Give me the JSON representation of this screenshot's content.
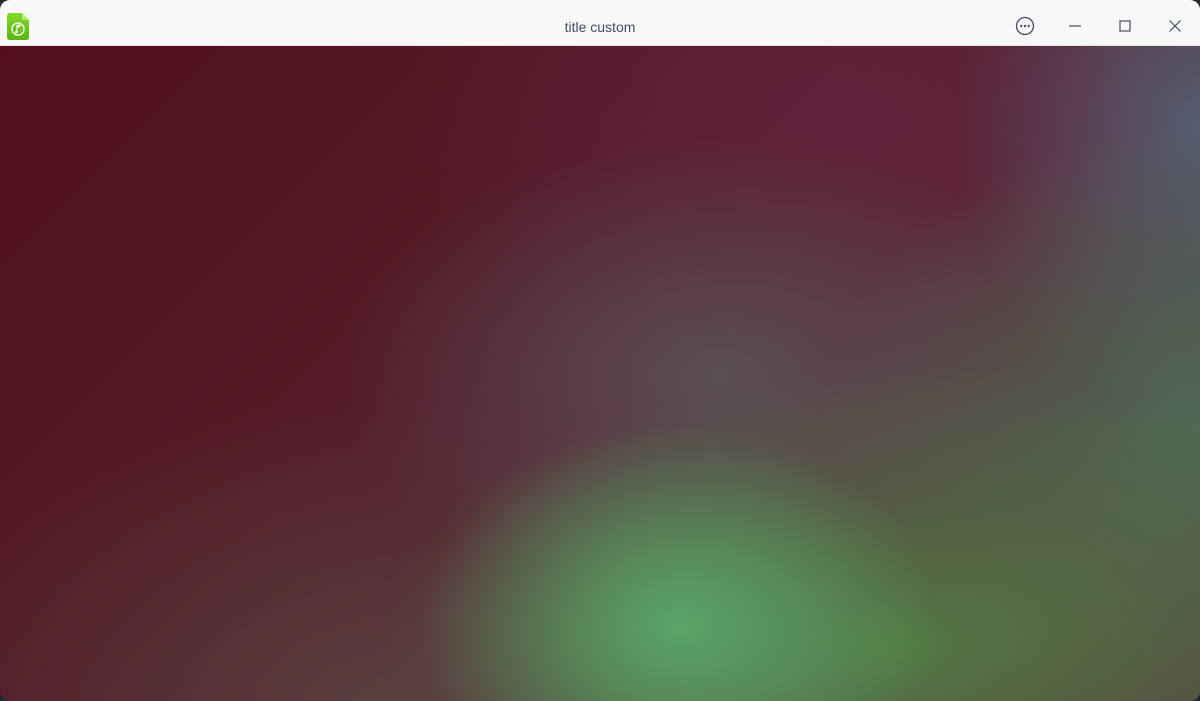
{
  "window": {
    "title": "title custom",
    "app_icon": "music-file-icon",
    "controls": {
      "menu_icon": "more-options-icon",
      "minimize_icon": "minimize-icon",
      "maximize_icon": "maximize-icon",
      "close_icon": "close-icon"
    },
    "colors": {
      "titlebar_bg": "#f8f8f8",
      "title_text": "#414d68",
      "app_icon_green": "#6fc51e"
    }
  },
  "content": {
    "background": "blurred-gradient",
    "colors": [
      "#511019",
      "#5b2636",
      "#558b5a",
      "#55606f"
    ]
  }
}
